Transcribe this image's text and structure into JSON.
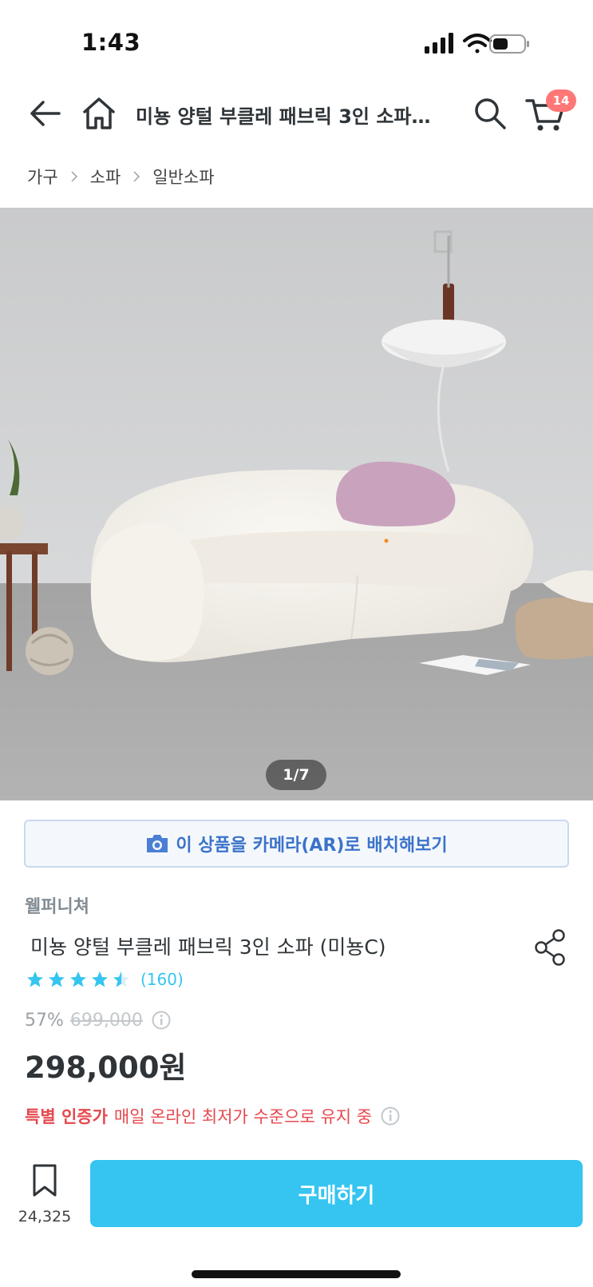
{
  "status_bar": {
    "time": "1:43"
  },
  "nav": {
    "title": "미뇽 양털 부클레 패브릭 3인 소파…",
    "cart_count": "14"
  },
  "breadcrumb": [
    "가구",
    "소파",
    "일반소파"
  ],
  "gallery": {
    "indicator": "1/7"
  },
  "ar_button": {
    "label": "이 상품을 카메라(AR)로 배치해보기"
  },
  "product": {
    "brand": "웰퍼니쳐",
    "name": "미뇽 양털 부클레 패브릭 3인 소파 (미뇽C)",
    "rating": 4.5,
    "review_count": "(160)",
    "discount": "57%",
    "original_price": "699,000",
    "price": "298,000원",
    "special_tag": "특별 인증가",
    "special_text": "매일 온라인 최저가 수준으로 유지 중"
  },
  "bottom_bar": {
    "bookmark_count": "24,325",
    "buy_label": "구매하기"
  },
  "colors": {
    "accent": "#35c5f0",
    "badge": "#ff7777",
    "special": "#e5484d",
    "ar_text": "#3b73c9"
  },
  "icons": [
    "back-arrow-icon",
    "home-icon",
    "search-icon",
    "cart-icon",
    "chevron-right-icon",
    "camera-icon",
    "share-icon",
    "star-icon",
    "info-icon",
    "bookmark-icon"
  ]
}
